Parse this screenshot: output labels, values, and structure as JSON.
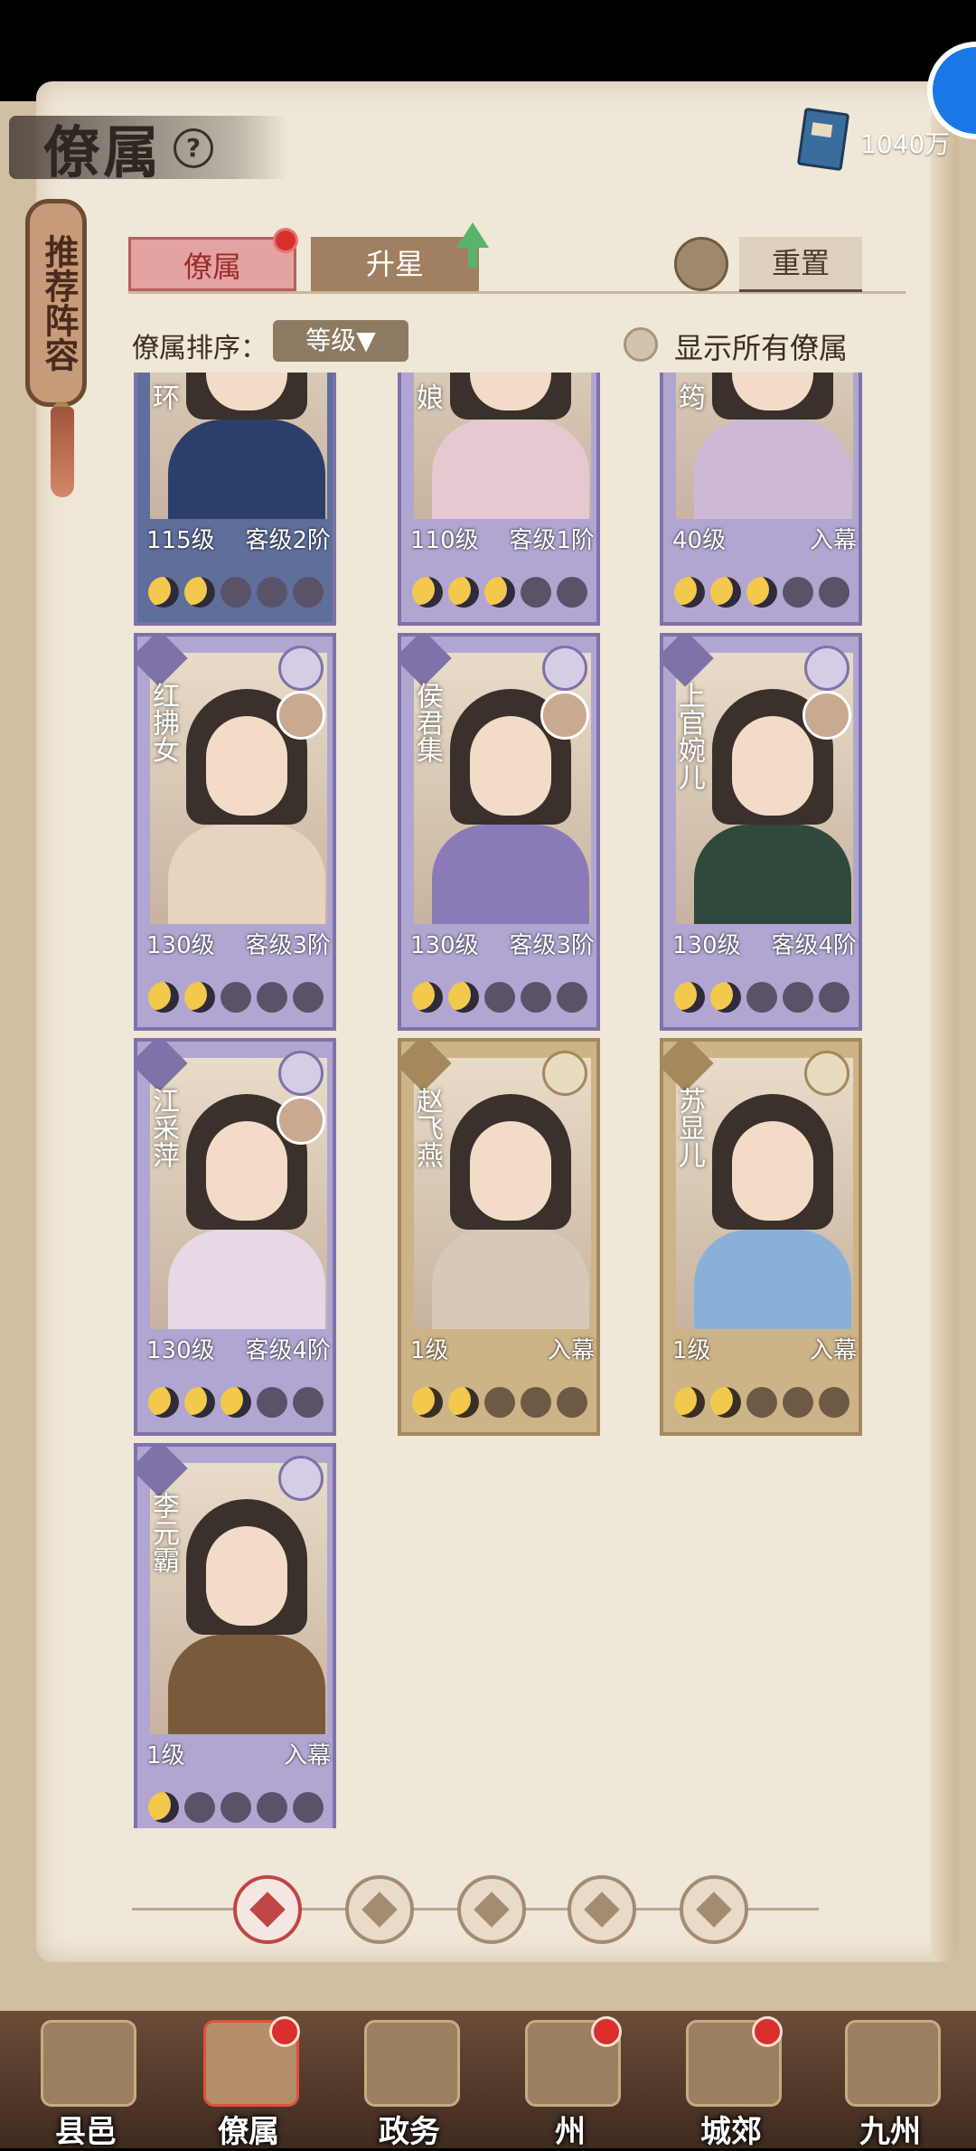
{
  "header": {
    "title": "僚属",
    "currency": "1040万"
  },
  "recommend": "推荐阵容",
  "tabs": [
    {
      "label": "僚属",
      "active": true
    },
    {
      "label": "升星",
      "active": false
    }
  ],
  "reset_label": "重置",
  "sort": {
    "label": "僚属排序：",
    "value": "等级▼"
  },
  "show_all_label": "显示所有僚属",
  "cards": [
    {
      "name": "环",
      "level": "115级",
      "rank": "客级2阶",
      "stars": 2,
      "frame": "blue"
    },
    {
      "name": "娘",
      "level": "110级",
      "rank": "客级1阶",
      "stars": 3,
      "frame": "purple"
    },
    {
      "name": "筠",
      "level": "40级",
      "rank": "入幕",
      "stars": 3,
      "frame": "purple"
    },
    {
      "name": "红拂女",
      "level": "130级",
      "rank": "客级3阶",
      "stars": 2,
      "frame": "purple"
    },
    {
      "name": "侯君集",
      "level": "130级",
      "rank": "客级3阶",
      "stars": 2,
      "frame": "purple"
    },
    {
      "name": "上官婉儿",
      "level": "130级",
      "rank": "客级4阶",
      "stars": 2,
      "frame": "purple"
    },
    {
      "name": "江采萍",
      "level": "130级",
      "rank": "客级4阶",
      "stars": 3,
      "frame": "purple"
    },
    {
      "name": "赵飞燕",
      "level": "1级",
      "rank": "入幕",
      "stars": 2,
      "frame": "gold"
    },
    {
      "name": "苏显儿",
      "level": "1级",
      "rank": "入幕",
      "stars": 2,
      "frame": "gold"
    },
    {
      "name": "李元霸",
      "level": "1级",
      "rank": "入幕",
      "stars": 1,
      "frame": "purple"
    }
  ],
  "filters": [
    "all-icon",
    "hat-icon",
    "gourd-icon",
    "fan-icon",
    "beast-icon"
  ],
  "nav": [
    {
      "label": "县邑",
      "icon": "town-icon",
      "badge": false
    },
    {
      "label": "僚属",
      "icon": "scroll-icon",
      "badge": true
    },
    {
      "label": "政务",
      "icon": "documents-icon",
      "badge": false
    },
    {
      "label": "州",
      "icon": "mountain-icon",
      "badge": true
    },
    {
      "label": "城郊",
      "icon": "outskirts-icon",
      "badge": true
    },
    {
      "label": "九州",
      "icon": "map-icon",
      "badge": false
    }
  ],
  "colors": {
    "accent_red": "#c04545",
    "purple_frame": "#7e72a8",
    "gold_frame": "#a4885e",
    "paper": "#efe7d8"
  }
}
